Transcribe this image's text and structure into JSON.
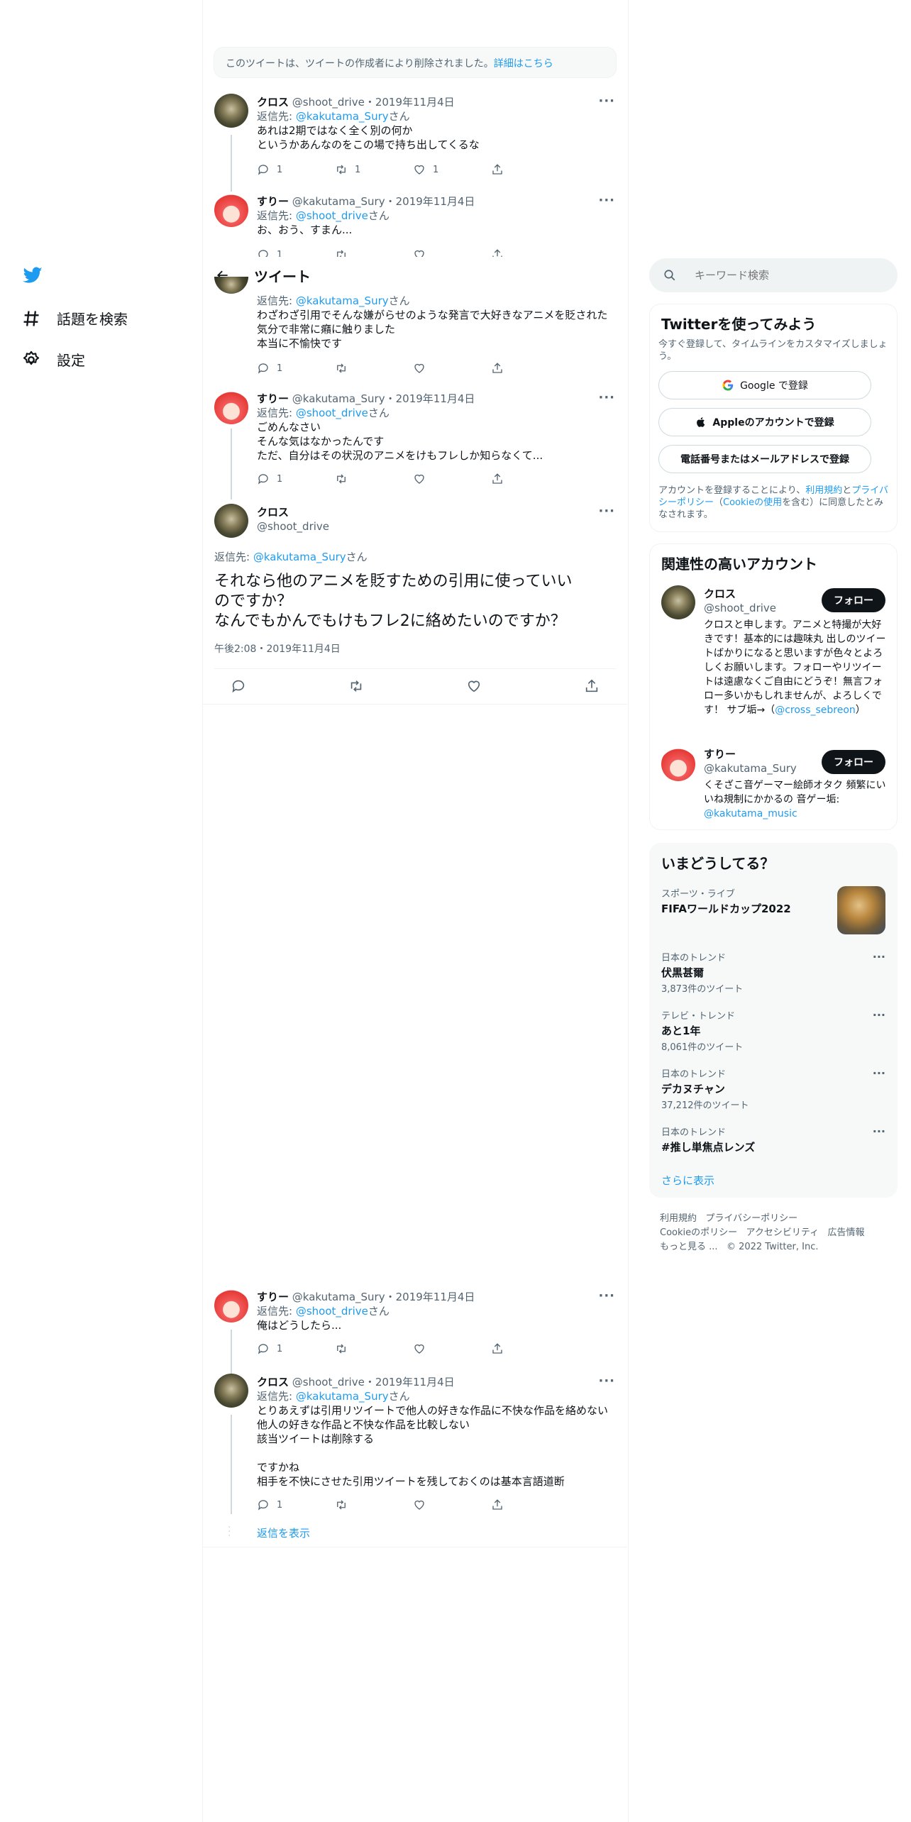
{
  "nav": {
    "items": [
      {
        "label": "話題を検索",
        "icon": "hashtag-icon"
      },
      {
        "label": "設定",
        "icon": "gear-icon"
      }
    ]
  },
  "deleted_notice": {
    "text": "このツイートは、ツイートの作成者により削除されました。",
    "link": "詳細はこちら"
  },
  "header": {
    "title": "ツイート"
  },
  "thread_top": [
    {
      "name": "クロス",
      "handle": "@shoot_drive",
      "date": "2019年11月4日",
      "reply_prefix": "返信先: ",
      "reply_to": "@kakutama_Sury",
      "reply_suffix": "さん",
      "text": "あれは2期ではなく全く別の何か\nというかあんなのをこの場で持ち出してくるな",
      "replies": "1",
      "retweets": "1",
      "likes": "1"
    },
    {
      "name": "すりー",
      "handle": "@kakutama_Sury",
      "date": "2019年11月4日",
      "reply_prefix": "返信先: ",
      "reply_to": "@shoot_drive",
      "reply_suffix": "さん",
      "text": "お、おう、すまん...",
      "replies": "1",
      "retweets": "",
      "likes": ""
    },
    {
      "name": "",
      "handle": "",
      "date": "",
      "reply_prefix": "返信先: ",
      "reply_to": "@kakutama_Sury",
      "reply_suffix": "さん",
      "text": "わざわざ引用でそんな嫌がらせのような発言で大好きなアニメを貶された\n気分で非常に癪に触りました\n本当に不愉快です",
      "replies": "1",
      "retweets": "",
      "likes": ""
    },
    {
      "name": "すりー",
      "handle": "@kakutama_Sury",
      "date": "2019年11月4日",
      "reply_prefix": "返信先: ",
      "reply_to": "@shoot_drive",
      "reply_suffix": "さん",
      "text": "ごめんなさい\nそんな気はなかったんです\nただ、自分はその状況のアニメをけもフレしか知らなくて...",
      "replies": "1",
      "retweets": "",
      "likes": ""
    }
  ],
  "main_tweet": {
    "name": "クロス",
    "handle": "@shoot_drive",
    "reply_prefix": "返信先: ",
    "reply_to": "@kakutama_Sury",
    "reply_suffix": "さん",
    "text": "それなら他のアニメを貶すための引用に使っていい\nのですか？\nなんでもかんでもけもフレ2に絡めたいのですか？",
    "time": "午後2:08・2019年11月4日"
  },
  "thread_bottom": [
    {
      "name": "すりー",
      "handle": "@kakutama_Sury",
      "date": "2019年11月4日",
      "reply_prefix": "返信先: ",
      "reply_to": "@shoot_drive",
      "reply_suffix": "さん",
      "text": "俺はどうしたら...",
      "replies": "1",
      "retweets": "",
      "likes": ""
    },
    {
      "name": "クロス",
      "handle": "@shoot_drive",
      "date": "2019年11月4日",
      "reply_prefix": "返信先: ",
      "reply_to": "@kakutama_Sury",
      "reply_suffix": "さん",
      "text": "とりあえずは引用リツイートで他人の好きな作品に不快な作品を絡めない\n他人の好きな作品と不快な作品を比較しない\n該当ツイートは削除する\n\nですかね\n相手を不快にさせた引用ツイートを残しておくのは基本言語道断",
      "replies": "1",
      "retweets": "",
      "likes": ""
    }
  ],
  "show_replies": "返信を表示",
  "search": {
    "placeholder": "キーワード検索"
  },
  "signup": {
    "title": "Twitterを使ってみよう",
    "subtitle": "今すぐ登録して、タイムラインをカスタマイズしましょう。",
    "google": "Google で登録",
    "apple": "Appleのアカウントで登録",
    "phone": "電話番号またはメールアドレスで登録",
    "legal_1": "アカウントを登録することにより、",
    "terms": "利用規約",
    "legal_2": "と",
    "privacy": "プライバシーポリシー",
    "legal_3": "（",
    "cookie": "Cookieの使用",
    "legal_4": "を含む）に同意したとみなされます。"
  },
  "relevant": {
    "title": "関連性の高いアカウント",
    "accounts": [
      {
        "name": "クロス",
        "handle": "@shoot_drive",
        "follow": "フォロー",
        "bio": "クロスと申します。アニメと特撮が大好きです！基本的には趣味丸 出しのツイートばかりになると思いますが色々とよろしくお願いします。フォローやリツイートは遠慮なくご自由にどうぞ！無言フォロー多いかもしれませんが、よろしくです！ サブ垢→（",
        "bio_link": "@cross_sebreon",
        "bio_end": "）"
      },
      {
        "name": "すりー",
        "handle": "@kakutama_Sury",
        "follow": "フォロー",
        "bio": "くそざこ音ゲーマー絵師オタク 頻繁にいいね規制にかかるの 音ゲー垢: ",
        "bio_link": "@kakutama_music",
        "bio_end": ""
      }
    ]
  },
  "trends": {
    "title": "いまどうしてる？",
    "items": [
      {
        "category": "スポーツ・ライブ",
        "name": "FIFAワールドカップ2022",
        "count": ""
      },
      {
        "category": "日本のトレンド",
        "name": "伏黒甚爾",
        "count": "3,873件のツイート"
      },
      {
        "category": "テレビ・トレンド",
        "name": "あと1年",
        "count": "8,061件のツイート"
      },
      {
        "category": "日本のトレンド",
        "name": "デカヌチャン",
        "count": "37,212件のツイート"
      },
      {
        "category": "日本のトレンド",
        "name": "#推し単焦点レンズ",
        "count": ""
      }
    ],
    "more": "さらに表示"
  },
  "footer": {
    "row1": [
      "利用規約",
      "プライバシーポリシー"
    ],
    "row2": [
      "Cookieのポリシー",
      "アクセシビリティ",
      "広告情報"
    ],
    "row3": [
      "もっと見る ...",
      "© 2022 Twitter, Inc."
    ]
  },
  "colors": {
    "accent": "#1d9bf0",
    "text": "#0f1419",
    "muted": "#536471",
    "border": "#eff3f4"
  }
}
